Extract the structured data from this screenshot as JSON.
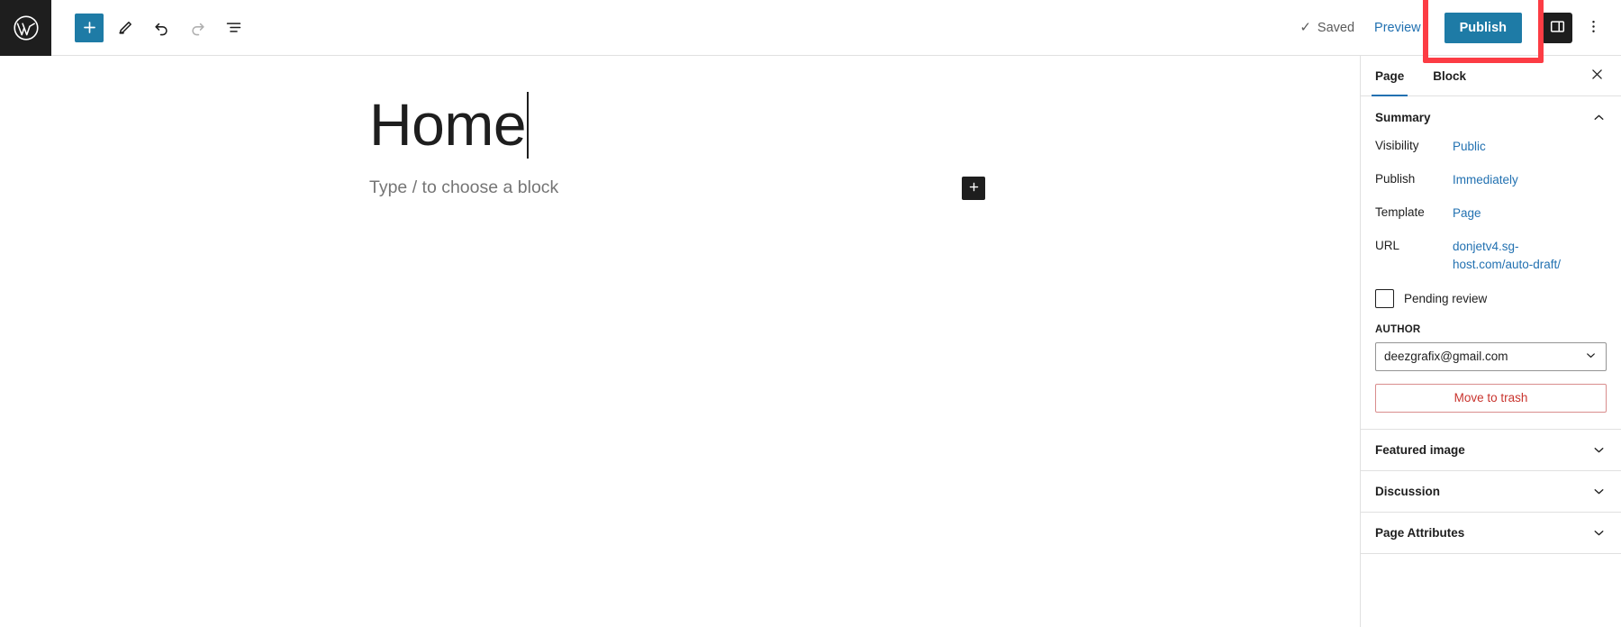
{
  "topbar": {
    "logo_icon": "wordpress-logo-icon",
    "tools": [
      {
        "name": "add-block-button",
        "icon": "plus-icon",
        "label": "Add block",
        "state": "primary"
      },
      {
        "name": "tools-button",
        "icon": "pencil-icon",
        "label": "Tools",
        "state": "default"
      },
      {
        "name": "undo-button",
        "icon": "undo-icon",
        "label": "Undo",
        "state": "default"
      },
      {
        "name": "redo-button",
        "icon": "redo-icon",
        "label": "Redo",
        "state": "disabled"
      },
      {
        "name": "list-view-button",
        "icon": "list-view-icon",
        "label": "List View",
        "state": "default"
      }
    ],
    "saved_label": "Saved",
    "saved_check": "✓",
    "preview_label": "Preview",
    "publish_label": "Publish",
    "sidebar_toggle_icon": "sidebar-panel-icon",
    "options_icon": "three-dots-vertical-icon"
  },
  "annotation": {
    "target": "publish-button",
    "color": "#fc3c44"
  },
  "editor": {
    "title": "Home",
    "block_placeholder": "Type / to choose a block",
    "inline_adder_icon": "plus-icon"
  },
  "sidebar": {
    "tabs": [
      {
        "label": "Page",
        "active": true
      },
      {
        "label": "Block",
        "active": false
      }
    ],
    "close_icon": "close-icon",
    "summary": {
      "title": "Summary",
      "collapse_icon": "chevron-up-icon",
      "rows": [
        {
          "label": "Visibility",
          "value": "Public"
        },
        {
          "label": "Publish",
          "value": "Immediately"
        },
        {
          "label": "Template",
          "value": "Page"
        },
        {
          "label": "URL",
          "value": "donjetv4.sg-host.com/auto-draft/"
        }
      ],
      "pending_review_label": "Pending review",
      "pending_review_checked": false,
      "author_legend": "AUTHOR",
      "author_value": "deezgrafix@gmail.com",
      "author_chevron_icon": "chevron-down-icon",
      "trash_label": "Move to trash"
    },
    "panels": [
      {
        "label": "Featured image",
        "icon": "chevron-down-icon"
      },
      {
        "label": "Discussion",
        "icon": "chevron-down-icon"
      },
      {
        "label": "Page Attributes",
        "icon": "chevron-down-icon"
      }
    ]
  },
  "colors": {
    "accent_blue": "#1e7ba6",
    "link_blue": "#2271b1",
    "annotation_red": "#fc3c44",
    "trash_red": "#c9342e",
    "dark": "#1e1e1e"
  }
}
